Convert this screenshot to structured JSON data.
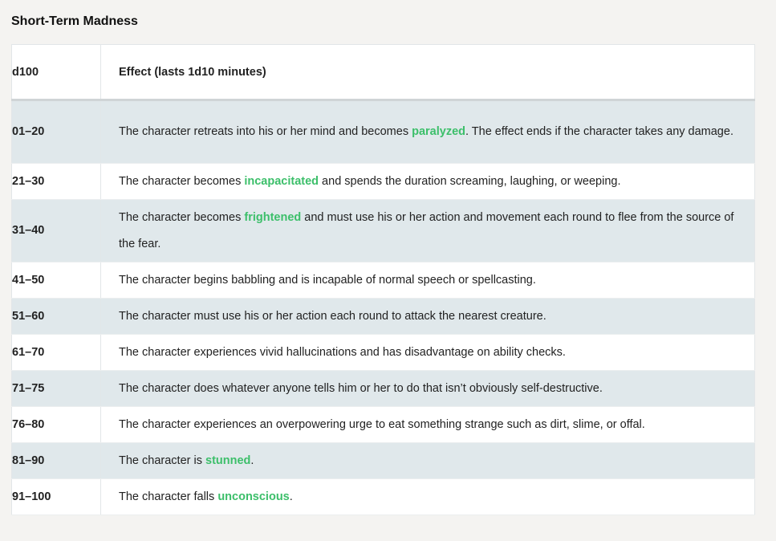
{
  "title": "Short-Term Madness",
  "colors": {
    "condition_link": "#3cbf6a",
    "stripe": "#e0e8eb"
  },
  "table": {
    "headers": {
      "die": "d100",
      "effect": "Effect (lasts 1d10 minutes)"
    },
    "rows": [
      {
        "roll": "01–20",
        "before": "The character retreats into his or her mind and becomes ",
        "condition": "paralyzed",
        "after": ". The effect ends if the character takes any damage."
      },
      {
        "roll": "21–30",
        "before": "The character becomes ",
        "condition": "incapacitated",
        "after": " and spends the duration screaming, laughing, or weeping."
      },
      {
        "roll": "31–40",
        "before": "The character becomes ",
        "condition": "frightened",
        "after": " and must use his or her action and movement each round to flee from the source of the fear."
      },
      {
        "roll": "41–50",
        "before": "The character begins babbling and is incapable of normal speech or spellcasting.",
        "condition": "",
        "after": ""
      },
      {
        "roll": "51–60",
        "before": "The character must use his or her action each round to attack the nearest creature.",
        "condition": "",
        "after": ""
      },
      {
        "roll": "61–70",
        "before": "The character experiences vivid hallucinations and has disadvantage on ability checks.",
        "condition": "",
        "after": ""
      },
      {
        "roll": "71–75",
        "before": "The character does whatever anyone tells him or her to do that isn’t obviously self-destructive.",
        "condition": "",
        "after": ""
      },
      {
        "roll": "76–80",
        "before": "The character experiences an overpowering urge to eat something strange such as dirt, slime, or offal.",
        "condition": "",
        "after": ""
      },
      {
        "roll": "81–90",
        "before": "The character is ",
        "condition": "stunned",
        "after": "."
      },
      {
        "roll": "91–100",
        "before": "The character falls ",
        "condition": "unconscious",
        "after": "."
      }
    ]
  }
}
